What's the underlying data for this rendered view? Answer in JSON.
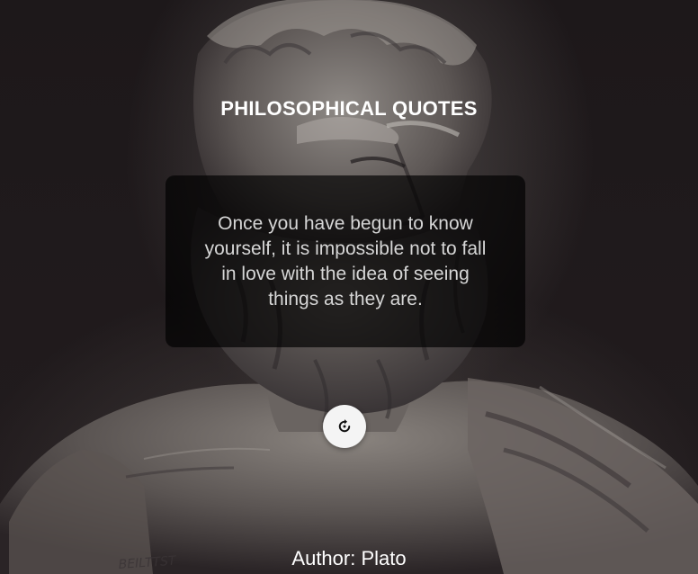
{
  "header": {
    "title": "PHILOSOPHICAL QUOTES"
  },
  "quote": {
    "text": "Once you have begun to know yourself, it is impossible not to fall in love with the idea of seeing things as they are."
  },
  "controls": {
    "refresh_icon": "refresh-icon"
  },
  "footer": {
    "author_label": "Author: Plato"
  },
  "background": {
    "inscription": "BEILTTST"
  }
}
